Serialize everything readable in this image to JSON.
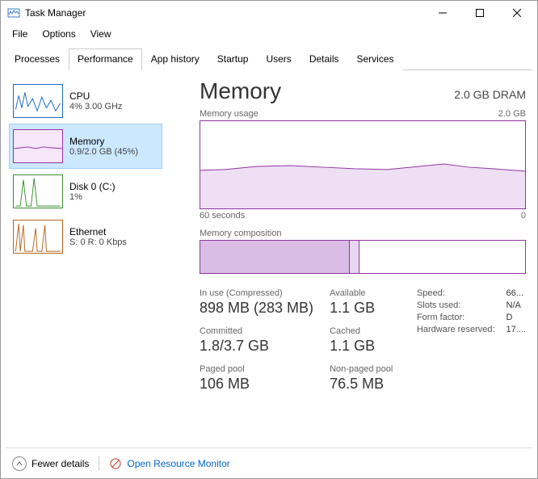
{
  "window": {
    "title": "Task Manager"
  },
  "menu": {
    "file": "File",
    "options": "Options",
    "view": "View"
  },
  "tabs": {
    "processes": "Processes",
    "performance": "Performance",
    "apphistory": "App history",
    "startup": "Startup",
    "users": "Users",
    "details": "Details",
    "services": "Services"
  },
  "sidebar": {
    "cpu": {
      "name": "CPU",
      "sub": "4% 3.00 GHz"
    },
    "memory": {
      "name": "Memory",
      "sub": "0.9/2.0 GB (45%)"
    },
    "disk": {
      "name": "Disk 0 (C:)",
      "sub": "1%"
    },
    "eth": {
      "name": "Ethernet",
      "sub": "S: 0 R: 0 Kbps"
    }
  },
  "main": {
    "title": "Memory",
    "subtitle": "2.0 GB DRAM",
    "usage_label": "Memory usage",
    "usage_max": "2.0 GB",
    "x_left": "60 seconds",
    "x_right": "0",
    "composition_label": "Memory composition"
  },
  "stats": {
    "inuse_label": "In use (Compressed)",
    "inuse_value": "898 MB (283 MB)",
    "available_label": "Available",
    "available_value": "1.1 GB",
    "committed_label": "Committed",
    "committed_value": "1.8/3.7 GB",
    "cached_label": "Cached",
    "cached_value": "1.1 GB",
    "paged_label": "Paged pool",
    "paged_value": "106 MB",
    "nonpaged_label": "Non-paged pool",
    "nonpaged_value": "76.5 MB"
  },
  "hw": {
    "speed_k": "Speed:",
    "speed_v": "66...",
    "slots_k": "Slots used:",
    "slots_v": "N/A",
    "form_k": "Form factor:",
    "form_v": "D",
    "res_k": "Hardware reserved:",
    "res_v": "17...."
  },
  "footer": {
    "fewer": "Fewer details",
    "monitor": "Open Resource Monitor"
  },
  "chart_data": {
    "type": "line",
    "title": "Memory usage",
    "ylabel": "",
    "ylim": [
      0,
      2.0
    ],
    "yunit": "GB",
    "xlabel_left": "60 seconds",
    "xlabel_right": "0",
    "x": [
      60,
      55,
      50,
      45,
      40,
      35,
      30,
      25,
      20,
      15,
      10,
      5,
      0
    ],
    "values": [
      0.88,
      0.89,
      0.93,
      0.94,
      0.93,
      0.91,
      0.9,
      0.93,
      0.96,
      0.93,
      0.9,
      0.89,
      0.87
    ]
  }
}
